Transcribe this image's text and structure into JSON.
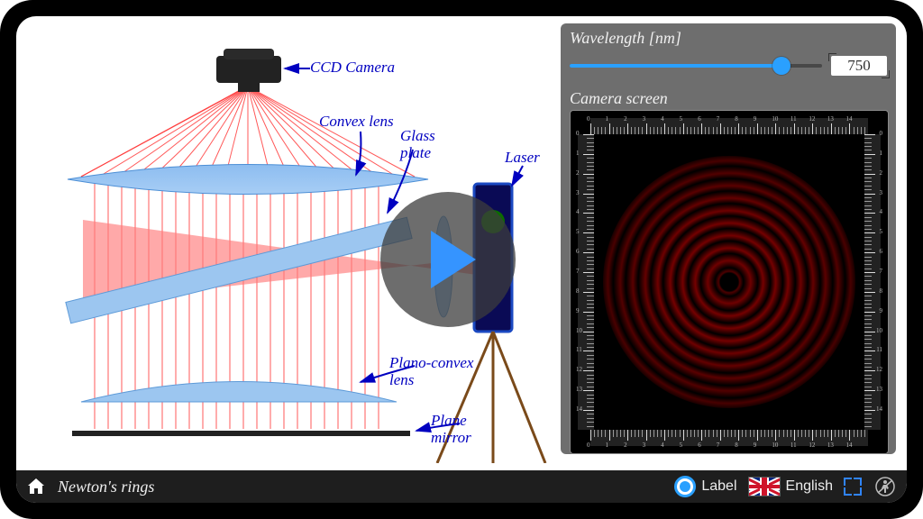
{
  "title": "Newton's rings",
  "controls": {
    "wavelength_label": "Wavelength [nm]",
    "wavelength_value": "750",
    "wavelength_fraction": 0.84,
    "camera_screen_label": "Camera screen",
    "ruler_ticks": [
      "0",
      "1",
      "2",
      "3",
      "4",
      "5",
      "6",
      "7",
      "8",
      "9",
      "10",
      "11",
      "12",
      "13",
      "14"
    ]
  },
  "diagram": {
    "ccd_camera": "CCD Camera",
    "convex_lens": "Convex lens",
    "glass_plate": "Glass plate",
    "laser": "Laser",
    "plano_convex_lens": "Plano-convex lens",
    "plane_mirror": "Plane mirror"
  },
  "bottombar": {
    "label_toggle": "Label",
    "language": "English"
  },
  "chart_data": {
    "type": "radial-fringe-pattern",
    "title": "Newton's rings interference pattern",
    "wavelength_nm": 750,
    "color": "#ff0000",
    "dark_ring_count_visible": 14,
    "ruler_range_each_side": [
      0,
      14
    ],
    "ruler_unit": "arbitrary scale ticks"
  }
}
